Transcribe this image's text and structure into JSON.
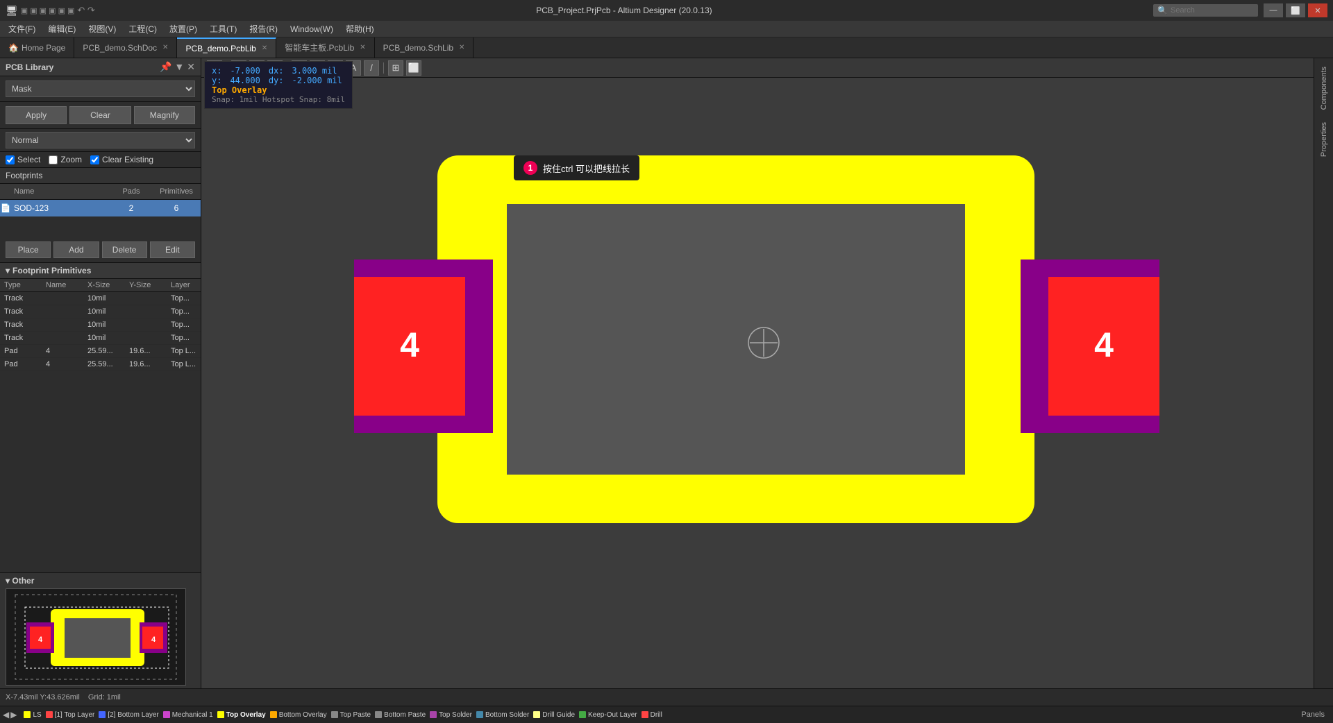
{
  "titlebar": {
    "title": "PCB_Project.PrjPcb - Altium Designer (20.0.13)",
    "search_placeholder": "Search",
    "win_buttons": [
      "minimize",
      "restore",
      "close"
    ]
  },
  "menubar": {
    "items": [
      "文件(F)",
      "编辑(E)",
      "视图(V)",
      "工程(C)",
      "放置(P)",
      "工具(T)",
      "报告(R)",
      "Window(W)",
      "帮助(H)"
    ]
  },
  "tabs": [
    {
      "label": "Home Page",
      "icon": "🏠",
      "active": false,
      "closable": false
    },
    {
      "label": "PCB_demo.SchDoc",
      "active": false,
      "closable": true
    },
    {
      "label": "PCB_demo.PcbLib",
      "active": true,
      "closable": true
    },
    {
      "label": "智能车主板.PcbLib",
      "active": false,
      "closable": true
    },
    {
      "label": "PCB_demo.SchLib",
      "active": false,
      "closable": true
    }
  ],
  "left_panel": {
    "title": "PCB Library",
    "mask_label": "Mask",
    "mask_value": "",
    "buttons": {
      "apply": "Apply",
      "clear": "Clear",
      "magnify": "Magnify"
    },
    "normal_options": [
      "Normal"
    ],
    "normal_selected": "Normal",
    "checkboxes": {
      "select": {
        "label": "Select",
        "checked": true
      },
      "zoom": {
        "label": "Zoom",
        "checked": false
      },
      "clear_existing": {
        "label": "Clear Existing",
        "checked": true
      }
    },
    "footprints_label": "Footprints",
    "table_headers": [
      "Name",
      "Pads",
      "Primitives"
    ],
    "table_rows": [
      {
        "icon": "📄",
        "name": "SOD-123",
        "pads": "2",
        "primitives": "6"
      }
    ],
    "crud_buttons": [
      "Place",
      "Add",
      "Delete",
      "Edit"
    ],
    "fp_primitives_label": "Footprint Primitives",
    "fp_table_headers": [
      "Type",
      "Name",
      "X-Size",
      "Y-Size",
      "Layer"
    ],
    "fp_table_rows": [
      {
        "type": "Track",
        "name": "",
        "xsize": "10mil",
        "ysize": "",
        "layer": "Top..."
      },
      {
        "type": "Track",
        "name": "",
        "xsize": "10mil",
        "ysize": "",
        "layer": "Top..."
      },
      {
        "type": "Track",
        "name": "",
        "xsize": "10mil",
        "ysize": "",
        "layer": "Top..."
      },
      {
        "type": "Track",
        "name": "",
        "xsize": "10mil",
        "ysize": "",
        "layer": "Top..."
      },
      {
        "type": "Pad",
        "name": "4",
        "xsize": "25.59...",
        "ysize": "19.6...",
        "layer": "Top L..."
      },
      {
        "type": "Pad",
        "name": "4",
        "xsize": "25.59...",
        "ysize": "19.6...",
        "layer": "Top L..."
      }
    ],
    "other_label": "Other"
  },
  "toolbar": {
    "buttons": [
      "▼",
      "↗",
      "□",
      "📊",
      "✏",
      "⬤",
      "?",
      "A",
      "/",
      "⊞",
      "⬜"
    ]
  },
  "coord": {
    "x_label": "x:",
    "x_val": "-7.000",
    "dx_label": "dx:",
    "dx_val": "3.000 mil",
    "y_label": "y:",
    "y_val": "44.000",
    "dy_label": "dy:",
    "dy_val": "-2.000 mil",
    "layer": "Top Overlay",
    "snap": "Snap: 1mil Hotspot Snap: 8mil"
  },
  "hint": {
    "number": "1",
    "text": "按住ctrl  可以把线拉长"
  },
  "statusbar": {
    "coords": "X-7.43mil Y:43.626mil",
    "grid": "Grid: 1mil"
  },
  "layerbar": {
    "items": [
      {
        "label": "LS",
        "color": "#ffff00",
        "active": false
      },
      {
        "label": "[1] Top Layer",
        "color": "#ff4444",
        "active": false
      },
      {
        "label": "[2] Bottom Layer",
        "color": "#4466ff",
        "active": false
      },
      {
        "label": "Mechanical 1",
        "color": "#cc44cc",
        "active": false
      },
      {
        "label": "Top Overlay",
        "color": "#ffff00",
        "active": true
      },
      {
        "label": "Bottom Overlay",
        "color": "#ffaa00",
        "active": false
      },
      {
        "label": "Top Paste",
        "color": "#888888",
        "active": false
      },
      {
        "label": "Bottom Paste",
        "color": "#888888",
        "active": false
      },
      {
        "label": "Top Solder",
        "color": "#aa44aa",
        "active": false
      },
      {
        "label": "Bottom Solder",
        "color": "#4488aa",
        "active": false
      },
      {
        "label": "Drill Guide",
        "color": "#ffff88",
        "active": false
      },
      {
        "label": "Keep-Out Layer",
        "color": "#44aa44",
        "active": false
      },
      {
        "label": "Drill",
        "color": "#ff4444",
        "active": false
      }
    ],
    "panels_label": "Panels"
  },
  "right_panels": [
    {
      "label": "Components"
    },
    {
      "label": "Properties"
    }
  ],
  "pcb": {
    "yellow_border_color": "#ffff00",
    "gray_fill_color": "#555555",
    "pad_outer_color": "#880088",
    "pad_inner_color": "#ff2222",
    "pad_text": "4",
    "cursor_color": "#aaaaaa"
  }
}
